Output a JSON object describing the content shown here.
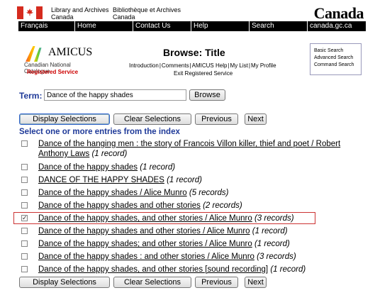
{
  "header": {
    "dept_en": [
      "Library and Archives",
      "Canada"
    ],
    "dept_fr": [
      "Bibliothèque et Archives",
      "Canada"
    ],
    "wordmark": "Canada"
  },
  "nav": [
    {
      "label": "Français",
      "w": 80
    },
    {
      "label": "Home",
      "w": 82
    },
    {
      "label": "Contact Us",
      "w": 82
    },
    {
      "label": "Help",
      "w": 82
    },
    {
      "label": "Search",
      "w": 82
    },
    {
      "label": "canada.gc.ca",
      "w": 82
    }
  ],
  "logo": {
    "name": "AMICUS",
    "sub": "Canadian National Catalogue",
    "registered": "Registered Service"
  },
  "page": {
    "title": "Browse: Title",
    "links": [
      "Introduction",
      "Comments",
      "AMICUS Help",
      "My List",
      "My Profile"
    ],
    "exit": "Exit Registered Service"
  },
  "side_search": [
    "Basic Search",
    "Advanced Search",
    "Command Search"
  ],
  "term": {
    "label": "Term:",
    "value": "Dance of the happy shades"
  },
  "buttons": {
    "browse": "Browse",
    "display": "Display Selections",
    "clear": "Clear Selections",
    "previous": "Previous",
    "next": "Next"
  },
  "instruction": "Select one or more entries from the index",
  "entries": [
    {
      "title": "Dance of the hanging men : the story of Francois Villon killer, thief and poet / Robert",
      "title2": "Anthony Laws",
      "count": "(1 record)",
      "checked": false
    },
    {
      "title": "Dance of the happy shades",
      "count": "(1 record)",
      "checked": false
    },
    {
      "title": "DANCE OF THE HAPPY SHADES",
      "count": "(1 record)",
      "checked": false
    },
    {
      "title": "Dance of the happy shades / Alice Munro",
      "count": "(5 records)",
      "checked": false
    },
    {
      "title": "Dance of the happy shades and other stories",
      "count": "(2 records)",
      "checked": false
    },
    {
      "title": "Dance of the happy shades, and other stories / Alice Munro",
      "count": "(3 records)",
      "checked": true
    },
    {
      "title": "Dance of the happy shades and other stories / Alice Munro",
      "count": "(1 record)",
      "checked": false
    },
    {
      "title": "Dance of the happy shades; and other stories / Alice Munro",
      "count": "(1 record)",
      "checked": false
    },
    {
      "title": "Dance of the happy shades : and other stories / Alice Munro",
      "count": "(3 records)",
      "checked": false
    },
    {
      "title": "Dance of the happy shades, and other stories [sound recording]",
      "count": "(1 record)",
      "checked": false
    }
  ]
}
